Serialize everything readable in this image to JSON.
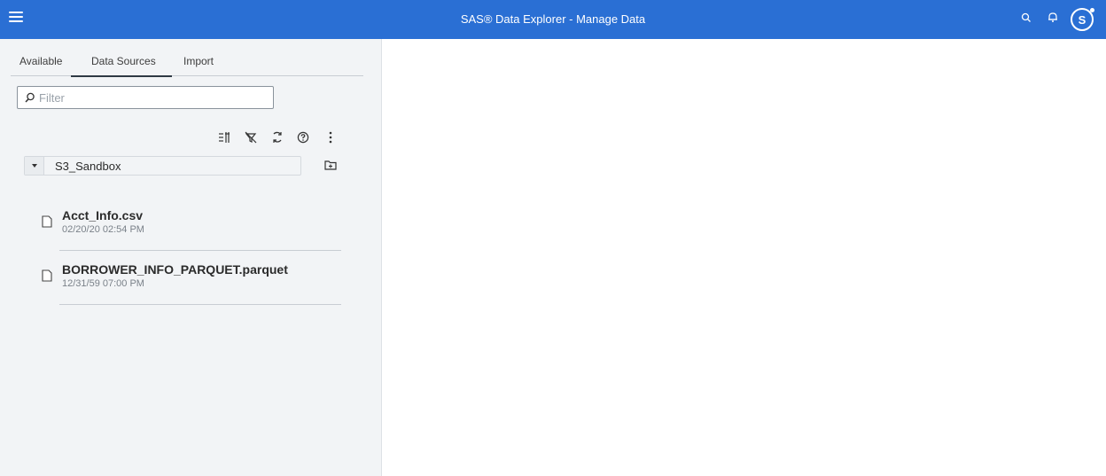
{
  "header": {
    "title": "SAS® Data Explorer - Manage Data",
    "menu_icon": "hamburger-menu-icon",
    "search_icon": "search-icon",
    "notifications_icon": "bell-icon",
    "avatar_letter": "S",
    "bar_color": "#2a6fd4"
  },
  "tabs": [
    {
      "label": "Available"
    },
    {
      "label": "Data Sources",
      "active": true
    },
    {
      "label": "Import"
    }
  ],
  "filter": {
    "placeholder": "Filter",
    "value": ""
  },
  "toolbar": {
    "icons": [
      "sort-icon",
      "clear-filter-icon",
      "refresh-icon",
      "help-icon",
      "more-options-icon"
    ]
  },
  "source": {
    "selected": "S3_Sandbox",
    "folder_icon": "new-folder-icon"
  },
  "files": [
    {
      "name": "Acct_Info.csv",
      "modified": "02/20/20 02:54 PM"
    },
    {
      "name": "BORROWER_INFO_PARQUET.parquet",
      "modified": "12/31/59 07:00 PM"
    }
  ]
}
